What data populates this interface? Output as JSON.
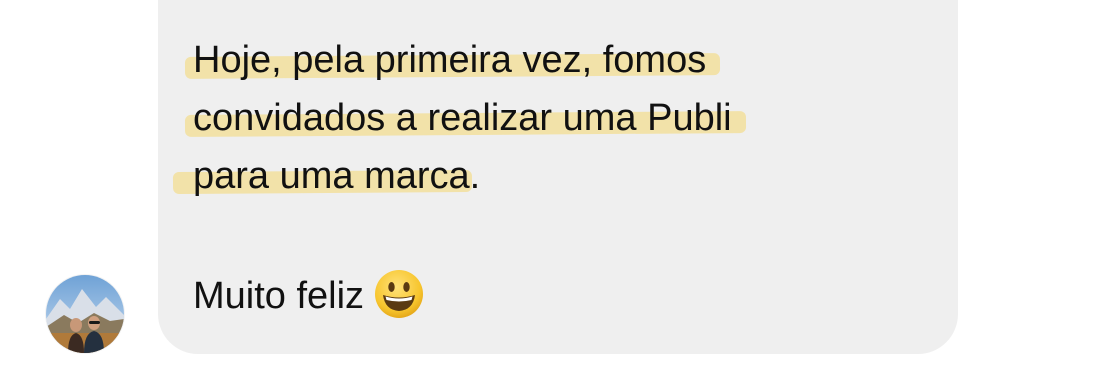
{
  "message": {
    "line1": "Hoje, pela primeira vez, fomos",
    "line2": "convidados a realizar uma Publi",
    "line3_highlighted": "para uma marca",
    "line3_tail": ".",
    "line4": "Muito feliz",
    "emoji": "grinning-face"
  },
  "colors": {
    "bubble": "#efefef",
    "highlight": "#f3dd8e",
    "text": "#111111"
  }
}
